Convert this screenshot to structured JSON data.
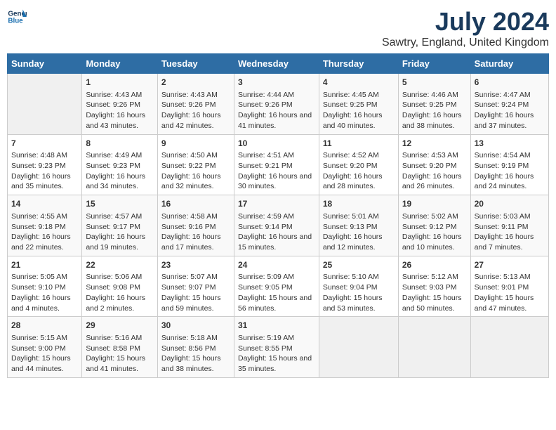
{
  "logo": {
    "line1": "General",
    "line2": "Blue"
  },
  "title": "July 2024",
  "subtitle": "Sawtry, England, United Kingdom",
  "days_of_week": [
    "Sunday",
    "Monday",
    "Tuesday",
    "Wednesday",
    "Thursday",
    "Friday",
    "Saturday"
  ],
  "weeks": [
    [
      {
        "day": "",
        "sunrise": "",
        "sunset": "",
        "daylight": ""
      },
      {
        "day": "1",
        "sunrise": "Sunrise: 4:43 AM",
        "sunset": "Sunset: 9:26 PM",
        "daylight": "Daylight: 16 hours and 43 minutes."
      },
      {
        "day": "2",
        "sunrise": "Sunrise: 4:43 AM",
        "sunset": "Sunset: 9:26 PM",
        "daylight": "Daylight: 16 hours and 42 minutes."
      },
      {
        "day": "3",
        "sunrise": "Sunrise: 4:44 AM",
        "sunset": "Sunset: 9:26 PM",
        "daylight": "Daylight: 16 hours and 41 minutes."
      },
      {
        "day": "4",
        "sunrise": "Sunrise: 4:45 AM",
        "sunset": "Sunset: 9:25 PM",
        "daylight": "Daylight: 16 hours and 40 minutes."
      },
      {
        "day": "5",
        "sunrise": "Sunrise: 4:46 AM",
        "sunset": "Sunset: 9:25 PM",
        "daylight": "Daylight: 16 hours and 38 minutes."
      },
      {
        "day": "6",
        "sunrise": "Sunrise: 4:47 AM",
        "sunset": "Sunset: 9:24 PM",
        "daylight": "Daylight: 16 hours and 37 minutes."
      }
    ],
    [
      {
        "day": "7",
        "sunrise": "Sunrise: 4:48 AM",
        "sunset": "Sunset: 9:23 PM",
        "daylight": "Daylight: 16 hours and 35 minutes."
      },
      {
        "day": "8",
        "sunrise": "Sunrise: 4:49 AM",
        "sunset": "Sunset: 9:23 PM",
        "daylight": "Daylight: 16 hours and 34 minutes."
      },
      {
        "day": "9",
        "sunrise": "Sunrise: 4:50 AM",
        "sunset": "Sunset: 9:22 PM",
        "daylight": "Daylight: 16 hours and 32 minutes."
      },
      {
        "day": "10",
        "sunrise": "Sunrise: 4:51 AM",
        "sunset": "Sunset: 9:21 PM",
        "daylight": "Daylight: 16 hours and 30 minutes."
      },
      {
        "day": "11",
        "sunrise": "Sunrise: 4:52 AM",
        "sunset": "Sunset: 9:20 PM",
        "daylight": "Daylight: 16 hours and 28 minutes."
      },
      {
        "day": "12",
        "sunrise": "Sunrise: 4:53 AM",
        "sunset": "Sunset: 9:20 PM",
        "daylight": "Daylight: 16 hours and 26 minutes."
      },
      {
        "day": "13",
        "sunrise": "Sunrise: 4:54 AM",
        "sunset": "Sunset: 9:19 PM",
        "daylight": "Daylight: 16 hours and 24 minutes."
      }
    ],
    [
      {
        "day": "14",
        "sunrise": "Sunrise: 4:55 AM",
        "sunset": "Sunset: 9:18 PM",
        "daylight": "Daylight: 16 hours and 22 minutes."
      },
      {
        "day": "15",
        "sunrise": "Sunrise: 4:57 AM",
        "sunset": "Sunset: 9:17 PM",
        "daylight": "Daylight: 16 hours and 19 minutes."
      },
      {
        "day": "16",
        "sunrise": "Sunrise: 4:58 AM",
        "sunset": "Sunset: 9:16 PM",
        "daylight": "Daylight: 16 hours and 17 minutes."
      },
      {
        "day": "17",
        "sunrise": "Sunrise: 4:59 AM",
        "sunset": "Sunset: 9:14 PM",
        "daylight": "Daylight: 16 hours and 15 minutes."
      },
      {
        "day": "18",
        "sunrise": "Sunrise: 5:01 AM",
        "sunset": "Sunset: 9:13 PM",
        "daylight": "Daylight: 16 hours and 12 minutes."
      },
      {
        "day": "19",
        "sunrise": "Sunrise: 5:02 AM",
        "sunset": "Sunset: 9:12 PM",
        "daylight": "Daylight: 16 hours and 10 minutes."
      },
      {
        "day": "20",
        "sunrise": "Sunrise: 5:03 AM",
        "sunset": "Sunset: 9:11 PM",
        "daylight": "Daylight: 16 hours and 7 minutes."
      }
    ],
    [
      {
        "day": "21",
        "sunrise": "Sunrise: 5:05 AM",
        "sunset": "Sunset: 9:10 PM",
        "daylight": "Daylight: 16 hours and 4 minutes."
      },
      {
        "day": "22",
        "sunrise": "Sunrise: 5:06 AM",
        "sunset": "Sunset: 9:08 PM",
        "daylight": "Daylight: 16 hours and 2 minutes."
      },
      {
        "day": "23",
        "sunrise": "Sunrise: 5:07 AM",
        "sunset": "Sunset: 9:07 PM",
        "daylight": "Daylight: 15 hours and 59 minutes."
      },
      {
        "day": "24",
        "sunrise": "Sunrise: 5:09 AM",
        "sunset": "Sunset: 9:05 PM",
        "daylight": "Daylight: 15 hours and 56 minutes."
      },
      {
        "day": "25",
        "sunrise": "Sunrise: 5:10 AM",
        "sunset": "Sunset: 9:04 PM",
        "daylight": "Daylight: 15 hours and 53 minutes."
      },
      {
        "day": "26",
        "sunrise": "Sunrise: 5:12 AM",
        "sunset": "Sunset: 9:03 PM",
        "daylight": "Daylight: 15 hours and 50 minutes."
      },
      {
        "day": "27",
        "sunrise": "Sunrise: 5:13 AM",
        "sunset": "Sunset: 9:01 PM",
        "daylight": "Daylight: 15 hours and 47 minutes."
      }
    ],
    [
      {
        "day": "28",
        "sunrise": "Sunrise: 5:15 AM",
        "sunset": "Sunset: 9:00 PM",
        "daylight": "Daylight: 15 hours and 44 minutes."
      },
      {
        "day": "29",
        "sunrise": "Sunrise: 5:16 AM",
        "sunset": "Sunset: 8:58 PM",
        "daylight": "Daylight: 15 hours and 41 minutes."
      },
      {
        "day": "30",
        "sunrise": "Sunrise: 5:18 AM",
        "sunset": "Sunset: 8:56 PM",
        "daylight": "Daylight: 15 hours and 38 minutes."
      },
      {
        "day": "31",
        "sunrise": "Sunrise: 5:19 AM",
        "sunset": "Sunset: 8:55 PM",
        "daylight": "Daylight: 15 hours and 35 minutes."
      },
      {
        "day": "",
        "sunrise": "",
        "sunset": "",
        "daylight": ""
      },
      {
        "day": "",
        "sunrise": "",
        "sunset": "",
        "daylight": ""
      },
      {
        "day": "",
        "sunrise": "",
        "sunset": "",
        "daylight": ""
      }
    ]
  ]
}
